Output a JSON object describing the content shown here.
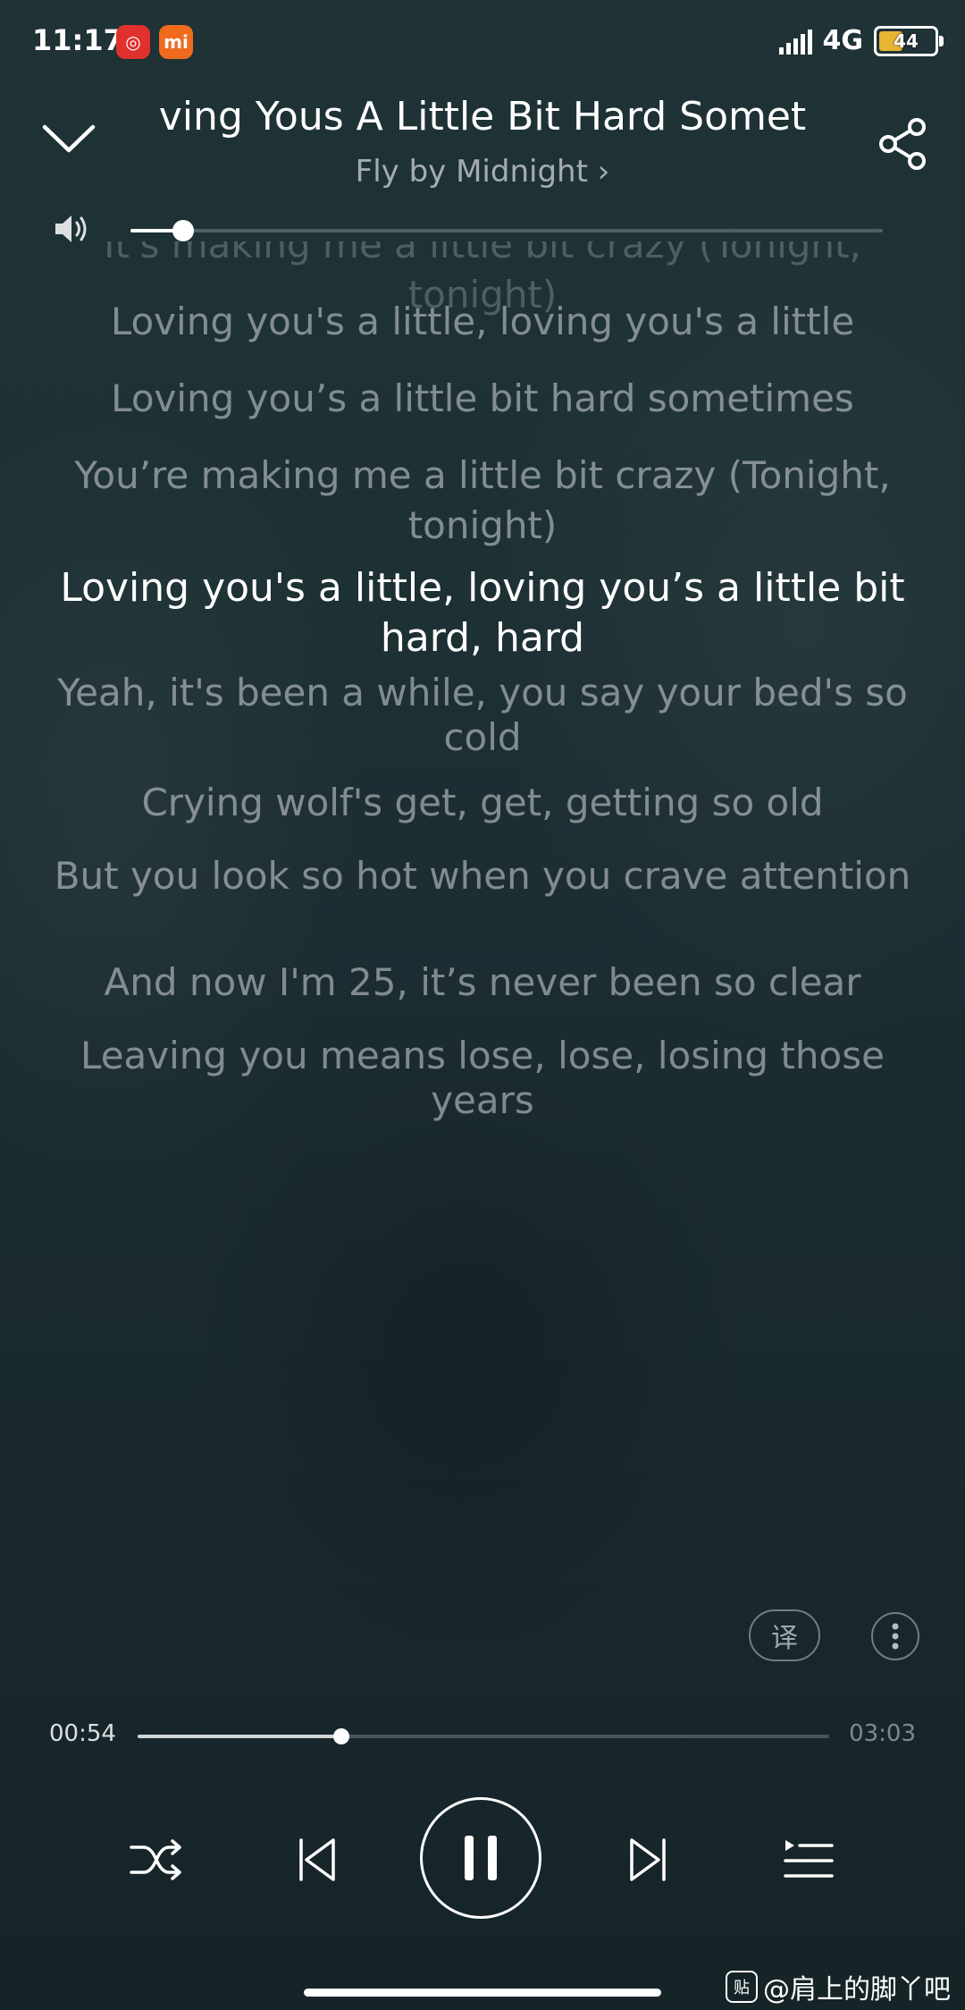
{
  "status_bar": {
    "time": "11:17",
    "network": "4G",
    "battery": "44",
    "app1_color": "#e0312d",
    "app2_color": "#f06a1e"
  },
  "header": {
    "title": "ving Yous A Little Bit Hard Somet",
    "artist": "Fly by Midnight ›"
  },
  "volume": {
    "level": 0.07
  },
  "lyrics": [
    "It's making me a little bit crazy (Tonight, tonight)",
    "Loving you's a little, loving you's a little",
    "Loving you’s a little bit hard sometimes",
    "You’re making me a little bit crazy (Tonight, tonight)",
    "Loving you's a little, loving you’s a little bit hard, hard",
    "Yeah, it's been a while, you say your bed's so cold",
    "Crying wolf's get, get, getting so old",
    "But you look so hot when you crave attention",
    "And now I'm 25, it’s never been so clear",
    "Leaving you means lose, lose, losing those years"
  ],
  "current_lyric_index": 4,
  "translate_label": "译",
  "progress": {
    "current": "00:54",
    "total": "03:03",
    "fraction": 0.295
  },
  "watermark": {
    "badge": "贴",
    "text": "@肩上的脚丫吧"
  }
}
